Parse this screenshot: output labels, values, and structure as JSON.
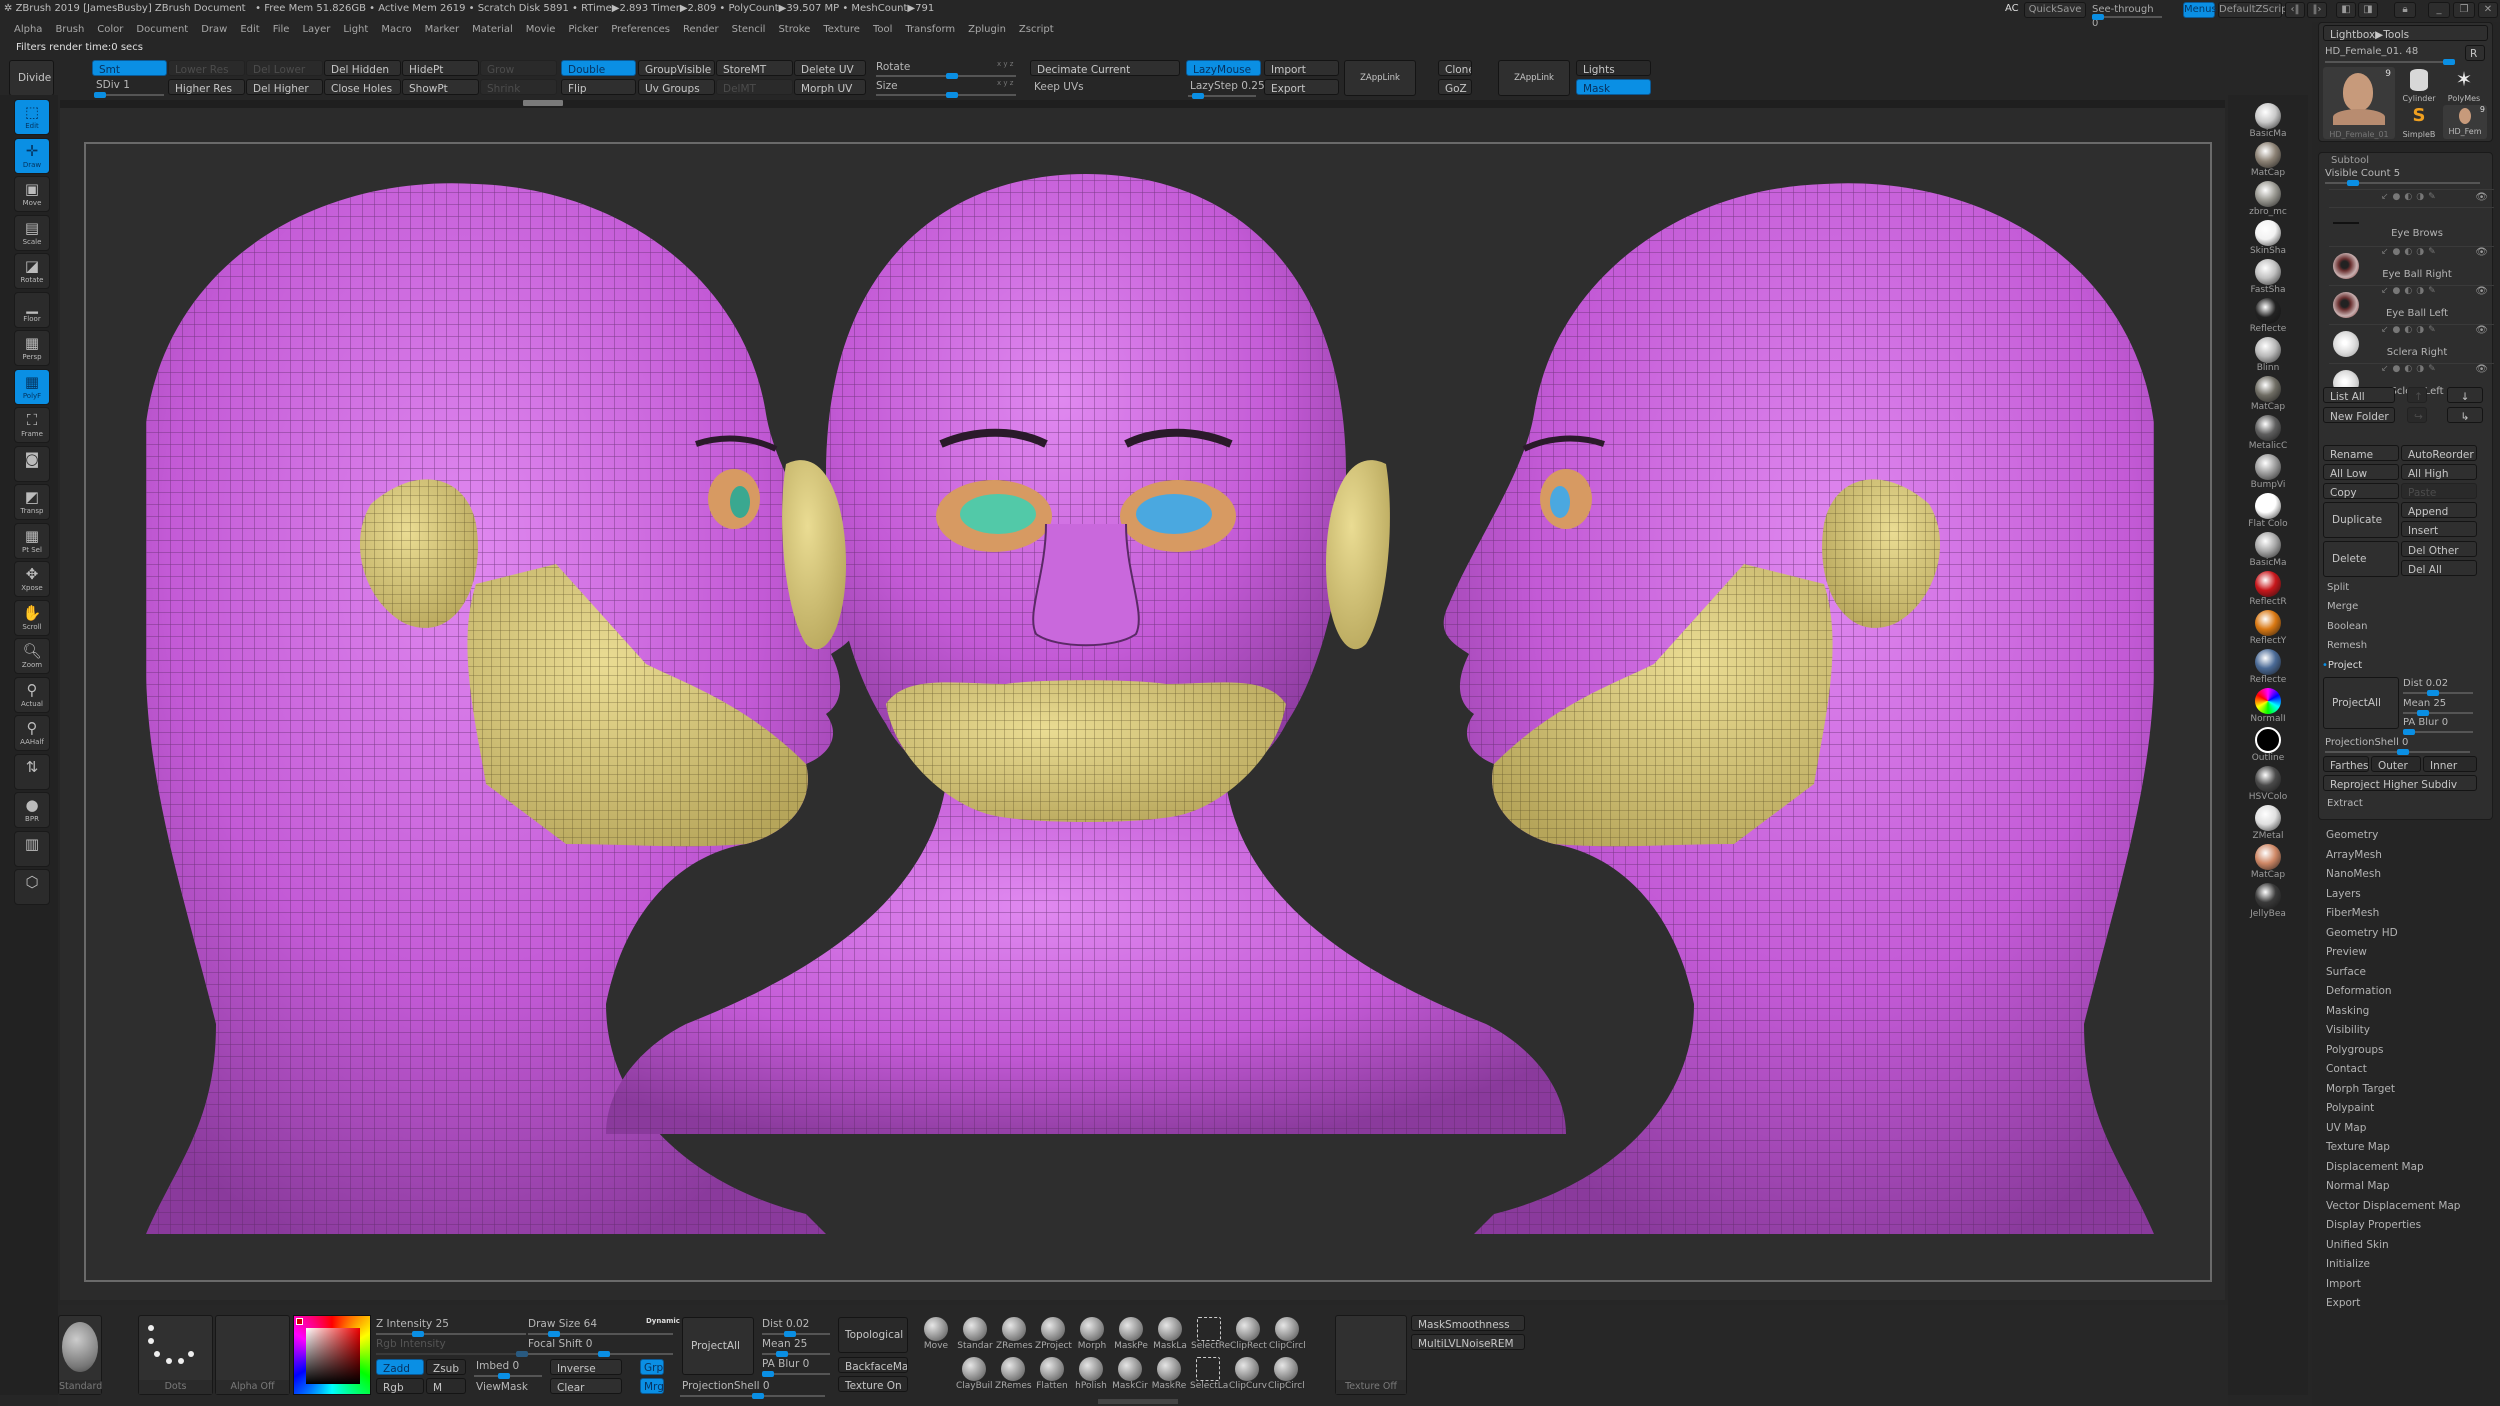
{
  "titlebar": {
    "title": "ZBrush 2019 [JamesBusby]   ZBrush Document",
    "stats": "• Free Mem 51.826GB • Active Mem 2619 • Scratch Disk 5891 • RTime▶2.893 Timer▶2.809 • PolyCount▶39.507 MP • MeshCount▶791"
  },
  "menubar": [
    "Alpha",
    "Brush",
    "Color",
    "Document",
    "Draw",
    "Edit",
    "File",
    "Layer",
    "Light",
    "Macro",
    "Marker",
    "Material",
    "Movie",
    "Picker",
    "Preferences",
    "Render",
    "Stencil",
    "Stroke",
    "Texture",
    "Tool",
    "Transform",
    "Zplugin",
    "Zscript"
  ],
  "status_text": "Filters render time:0 secs",
  "topright": {
    "ac": "AC",
    "quicksave": "QuickSave",
    "see_through_label": "See-through",
    "see_through_value": "0",
    "menus": "Menus",
    "default_zscript": "DefaultZScript"
  },
  "toolbar": {
    "divide": "Divide",
    "smt": "Smt",
    "sdiv_label": "SDiv",
    "sdiv_value": "1",
    "lower_res": "Lower Res",
    "higher_res": "Higher Res",
    "del_lower": "Del Lower",
    "del_higher": "Del Higher",
    "del_hidden": "Del Hidden",
    "close_holes": "Close Holes",
    "hidept": "HidePt",
    "showpt": "ShowPt",
    "grow": "Grow",
    "shrink": "Shrink",
    "double": "Double",
    "flip": "Flip",
    "group_visible": "GroupVisible",
    "uv_groups": "Uv Groups",
    "storemt": "StoreMT",
    "delmt": "DelMT",
    "delete_uv": "Delete UV",
    "morph_uv": "Morph UV",
    "rotate": "Rotate",
    "size": "Size",
    "xyz": "x y z",
    "decimate_current": "Decimate Current",
    "keep_uvs": "Keep UVs",
    "lazymouse": "LazyMouse",
    "lazystep_label": "LazyStep",
    "lazystep_value": "0.25",
    "import": "Import",
    "export": "Export",
    "zapplink": "ZAppLink",
    "clone": "Clone",
    "goz": "GoZ",
    "zapplink2": "ZAppLink",
    "lights": "Lights",
    "mask": "Mask"
  },
  "left_tools": [
    {
      "label": "Edit",
      "icon": "edit-icon",
      "active": true
    },
    {
      "label": "Draw",
      "icon": "draw-icon",
      "active": true
    },
    {
      "label": "Move",
      "icon": "move-icon",
      "active": false
    },
    {
      "label": "Scale",
      "icon": "scale-icon",
      "active": false
    },
    {
      "label": "Rotate",
      "icon": "rotate-icon",
      "active": false
    },
    {
      "label": "Floor",
      "icon": "floor-icon",
      "active": false
    },
    {
      "label": "Persp",
      "icon": "persp-icon",
      "active": false
    },
    {
      "label": "PolyF",
      "icon": "polyframe-icon",
      "active": true
    },
    {
      "label": "Frame",
      "icon": "frame-icon",
      "active": false
    },
    {
      "label": "",
      "icon": "camera-icon",
      "active": false
    },
    {
      "label": "Transp",
      "icon": "transparency-icon",
      "active": false
    },
    {
      "label": "Pt Sel",
      "icon": "point-select-icon",
      "active": false
    },
    {
      "label": "Xpose",
      "icon": "xpose-icon",
      "active": false
    },
    {
      "label": "Scroll",
      "icon": "scroll-icon",
      "active": false
    },
    {
      "label": "Zoom",
      "icon": "zoom-icon",
      "active": false
    },
    {
      "label": "Actual",
      "icon": "actual-icon",
      "active": false
    },
    {
      "label": "AAHalf",
      "icon": "aahalf-icon",
      "active": false
    },
    {
      "label": "",
      "icon": "flip-v-icon",
      "active": false
    },
    {
      "label": "BPR",
      "icon": "bpr-icon",
      "active": false
    },
    {
      "label": "",
      "icon": "layers-icon",
      "active": false
    },
    {
      "label": "",
      "icon": "cube-icon",
      "active": false
    }
  ],
  "materials": [
    {
      "label": "BasicMa",
      "color": "#c9c9c9"
    },
    {
      "label": "MatCap",
      "color": "#8c8275"
    },
    {
      "label": "zbro_mc",
      "color": "#9a9992"
    },
    {
      "label": "SkinSha",
      "color": "#f2f2f2"
    },
    {
      "label": "FastSha",
      "color": "#c0c0c0"
    },
    {
      "label": "Reflecte",
      "color": "#222222"
    },
    {
      "label": "Blinn",
      "color": "#b8b8b8"
    },
    {
      "label": "MatCap",
      "color": "#6f6d64"
    },
    {
      "label": "MetalicC",
      "color": "#5e5e5e"
    },
    {
      "label": "BumpVi",
      "color": "#9c9c9c"
    },
    {
      "label": "Flat Colo",
      "color": "#ffffff"
    },
    {
      "label": "BasicMa",
      "color": "#a8a8a8"
    },
    {
      "label": "ReflectR",
      "color": "#c8161b"
    },
    {
      "label": "ReflectY",
      "color": "#d97812"
    },
    {
      "label": "Reflecte",
      "color": "#4a6a96"
    },
    {
      "label": "NormalI",
      "color": "#c865d8"
    },
    {
      "label": "Outline",
      "color": "#000000"
    },
    {
      "label": "HSVColo",
      "color": "#4a4a4a"
    },
    {
      "label": "ZMetal",
      "color": "#e0e0e0"
    },
    {
      "label": "MatCap",
      "color": "#cf8866"
    },
    {
      "label": "JellyBea",
      "color": "#3a3a3a"
    }
  ],
  "tray": {
    "lightbox_tools": "Lightbox▶Tools",
    "tool_name": "HD_Female_01. 48",
    "r_button": "R",
    "tools": [
      {
        "name": "HD_Female_01",
        "badge": "9"
      },
      {
        "name": "Cylinder",
        "badge": ""
      },
      {
        "name": "PolyMes",
        "badge": ""
      },
      {
        "name": "SimpleB",
        "badge": ""
      },
      {
        "name": "HD_Fem",
        "badge": "9"
      }
    ],
    "subtool_title": "Subtool",
    "visible_count_label": "Visible Count",
    "visible_count_value": "5",
    "subtools": [
      {
        "name": "Eye Brows",
        "color": "#2e2e2e"
      },
      {
        "name": "Eye Ball Right",
        "color": "#7a2a2a"
      },
      {
        "name": "Eye Ball Left",
        "color": "#7a2a2a"
      },
      {
        "name": "Sclera Right",
        "color": "#ececec"
      },
      {
        "name": "Sclera Left",
        "color": "#ececec"
      }
    ],
    "list_all": "List All",
    "new_folder": "New Folder",
    "rename": "Rename",
    "auto_reorder": "AutoReorder",
    "all_low": "All Low",
    "all_high": "All High",
    "copy": "Copy",
    "paste": "Paste",
    "duplicate": "Duplicate",
    "append": "Append",
    "insert": "Insert",
    "delete": "Delete",
    "del_other": "Del Other",
    "del_all": "Del All",
    "split": "Split",
    "merge": "Merge",
    "boolean": "Boolean",
    "remesh": "Remesh",
    "project": "Project",
    "project_all": "ProjectAll",
    "dist_label": "Dist",
    "dist_value": "0.02",
    "mean_label": "Mean",
    "mean_value": "25",
    "pa_blur_label": "PA Blur",
    "pa_blur_value": "0",
    "projection_shell_label": "ProjectionShell",
    "projection_shell_value": "0",
    "farthest": "Farthest",
    "outer": "Outer",
    "inner": "Inner",
    "reproject": "Reproject Higher Subdiv",
    "extract": "Extract",
    "menu": [
      "Geometry",
      "ArrayMesh",
      "NanoMesh",
      "Layers",
      "FiberMesh",
      "Geometry HD",
      "Preview",
      "Surface",
      "Deformation",
      "Masking",
      "Visibility",
      "Polygroups",
      "Contact",
      "Morph Target",
      "Polypaint",
      "UV Map",
      "Texture Map",
      "Displacement Map",
      "Normal Map",
      "Vector Displacement Map",
      "Display Properties",
      "Unified Skin",
      "Initialize",
      "Import",
      "Export"
    ]
  },
  "bottom": {
    "brush_label": "Standard",
    "stroke_label": "Dots",
    "alpha_label": "Alpha Off",
    "z_intensity_label": "Z Intensity",
    "z_intensity_value": "25",
    "rgb_intensity": "Rgb Intensity",
    "zadd": "Zadd",
    "zsub": "Zsub",
    "rgb": "Rgb",
    "m": "M",
    "imbed_label": "Imbed",
    "imbed_value": "0",
    "viewmask": "ViewMask",
    "draw_size_label": "Draw Size",
    "draw_size_value": "64",
    "dynamic": "Dynamic",
    "focal_shift_label": "Focal Shift",
    "focal_shift_value": "0",
    "inverse": "Inverse",
    "clear": "Clear",
    "grp": "Grp",
    "mrg": "Mrg",
    "project_all": "ProjectAll",
    "dist_label": "Dist",
    "dist_value": "0.02",
    "mean_label": "Mean",
    "mean_value": "25",
    "pa_blur_label": "PA Blur",
    "pa_blur_value": "0",
    "projection_shell_label": "ProjectionShell",
    "projection_shell_value": "0",
    "topological": "Topological",
    "backface_mask": "BackfaceMask",
    "texture_on": "Texture On",
    "brushes_row1": [
      "Move",
      "Standar",
      "ZRemes",
      "ZProject",
      "Morph",
      "MaskPe",
      "MaskLa",
      "SelectRe",
      "ClipRect",
      "ClipCircl"
    ],
    "brushes_row2": [
      "ClayBuil",
      "ZRemes",
      "Flatten",
      "hPolish",
      "MaskCir",
      "MaskRe",
      "SelectLa",
      "ClipCurv",
      "ClipCircl"
    ],
    "texture_off": "Texture Off",
    "mask_smoothness": "MaskSmoothness",
    "multi_lvl_noise": "MultiLVLNoiseREM"
  },
  "colors": {
    "accent": "#0a8fe4",
    "mesh_purple": "#c35ad6",
    "mesh_yellow": "#d8c77a",
    "eye_orange": "#d79a62",
    "eye_green": "#52c9a8",
    "eye_blue": "#4aa8e0"
  }
}
